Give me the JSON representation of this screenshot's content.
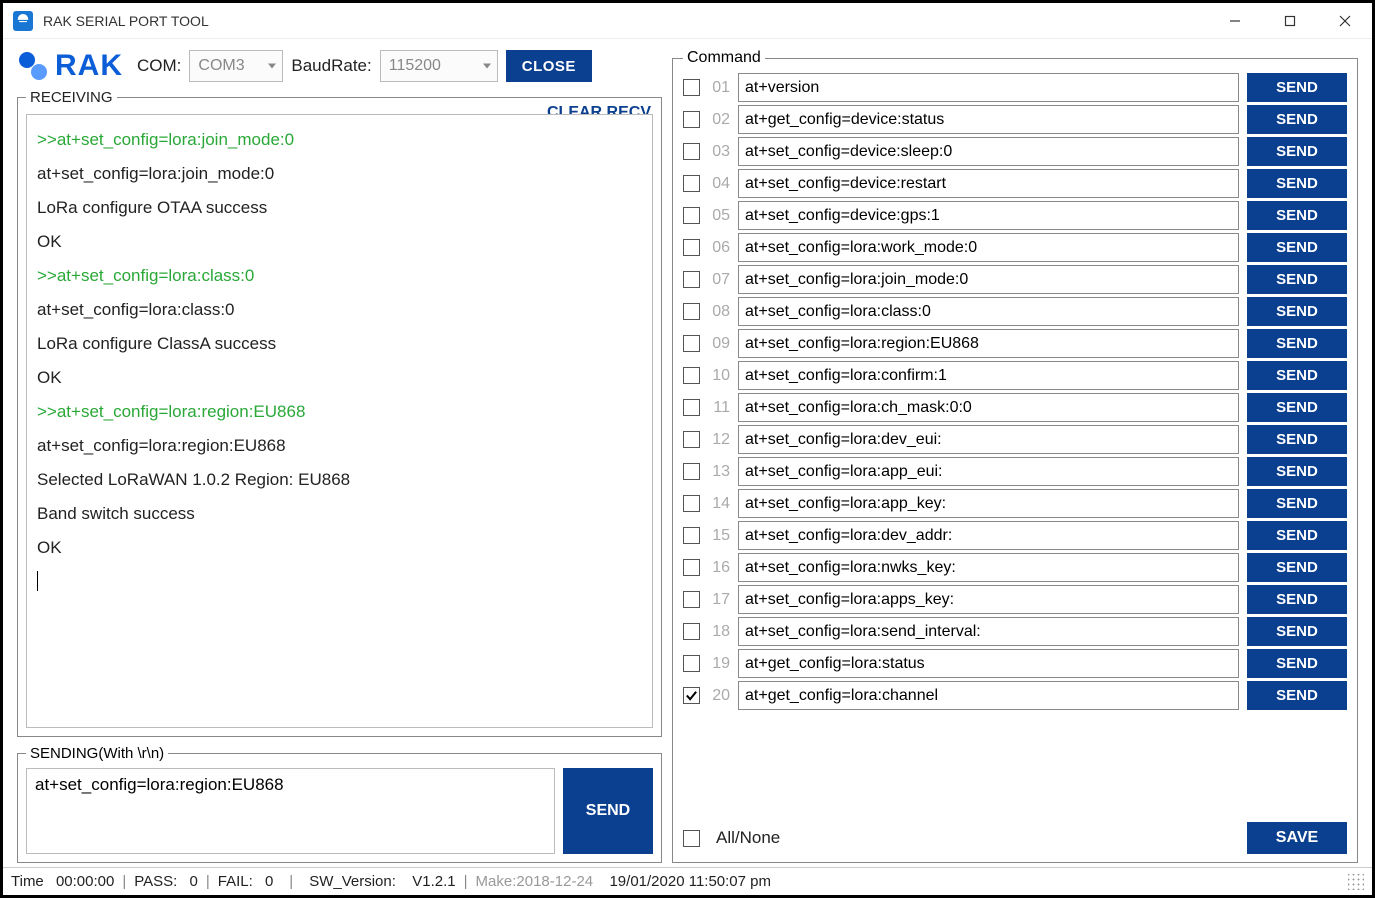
{
  "window": {
    "title": "RAK SERIAL PORT TOOL"
  },
  "toolbar": {
    "logo_text": "RAK",
    "com_label": "COM:",
    "com_value": "COM3",
    "baud_label": "BaudRate:",
    "baud_value": "115200",
    "close_label": "CLOSE"
  },
  "receiving": {
    "legend": "RECEIVING",
    "clear_label": "CLEAR RECV",
    "lines": [
      {
        "type": "cmd",
        "text": ">>at+set_config=lora:join_mode:0"
      },
      {
        "type": "resp",
        "text": "at+set_config=lora:join_mode:0"
      },
      {
        "type": "resp",
        "text": "LoRa configure OTAA success"
      },
      {
        "type": "resp",
        "text": "OK"
      },
      {
        "type": "cmd",
        "text": ">>at+set_config=lora:class:0"
      },
      {
        "type": "resp",
        "text": "at+set_config=lora:class:0"
      },
      {
        "type": "resp",
        "text": "LoRa configure ClassA success"
      },
      {
        "type": "resp",
        "text": "OK"
      },
      {
        "type": "cmd",
        "text": ">>at+set_config=lora:region:EU868"
      },
      {
        "type": "resp",
        "text": "at+set_config=lora:region:EU868"
      },
      {
        "type": "resp",
        "text": "Selected LoRaWAN 1.0.2 Region: EU868"
      },
      {
        "type": "resp",
        "text": "Band switch success"
      },
      {
        "type": "resp",
        "text": "OK"
      }
    ]
  },
  "sending": {
    "legend": "SENDING(With \\r\\n)",
    "value": "at+set_config=lora:region:EU868",
    "send_label": "SEND"
  },
  "command": {
    "legend": "Command",
    "send_label": "SEND",
    "save_label": "SAVE",
    "allnone_label": "All/None",
    "rows": [
      {
        "num": "01",
        "checked": false,
        "value": "at+version"
      },
      {
        "num": "02",
        "checked": false,
        "value": "at+get_config=device:status"
      },
      {
        "num": "03",
        "checked": false,
        "value": "at+set_config=device:sleep:0"
      },
      {
        "num": "04",
        "checked": false,
        "value": "at+set_config=device:restart"
      },
      {
        "num": "05",
        "checked": false,
        "value": "at+set_config=device:gps:1"
      },
      {
        "num": "06",
        "checked": false,
        "value": "at+set_config=lora:work_mode:0"
      },
      {
        "num": "07",
        "checked": false,
        "value": "at+set_config=lora:join_mode:0"
      },
      {
        "num": "08",
        "checked": false,
        "value": "at+set_config=lora:class:0"
      },
      {
        "num": "09",
        "checked": false,
        "value": "at+set_config=lora:region:EU868"
      },
      {
        "num": "10",
        "checked": false,
        "value": "at+set_config=lora:confirm:1"
      },
      {
        "num": "11",
        "checked": false,
        "value": "at+set_config=lora:ch_mask:0:0"
      },
      {
        "num": "12",
        "checked": false,
        "value": "at+set_config=lora:dev_eui:"
      },
      {
        "num": "13",
        "checked": false,
        "value": "at+set_config=lora:app_eui:"
      },
      {
        "num": "14",
        "checked": false,
        "value": "at+set_config=lora:app_key:"
      },
      {
        "num": "15",
        "checked": false,
        "value": "at+set_config=lora:dev_addr:"
      },
      {
        "num": "16",
        "checked": false,
        "value": "at+set_config=lora:nwks_key:"
      },
      {
        "num": "17",
        "checked": false,
        "value": "at+set_config=lora:apps_key:"
      },
      {
        "num": "18",
        "checked": false,
        "value": "at+set_config=lora:send_interval:"
      },
      {
        "num": "19",
        "checked": false,
        "value": "at+get_config=lora:status"
      },
      {
        "num": "20",
        "checked": true,
        "value": "at+get_config=lora:channel"
      }
    ]
  },
  "status": {
    "time_label": "Time",
    "time_value": "00:00:00",
    "pass_label": "PASS:",
    "pass_value": "0",
    "fail_label": "FAIL:",
    "fail_value": "0",
    "sw_label": "SW_Version:",
    "sw_value": "V1.2.1",
    "make": "Make:2018-12-24",
    "datetime": "19/01/2020 11:50:07 pm"
  }
}
